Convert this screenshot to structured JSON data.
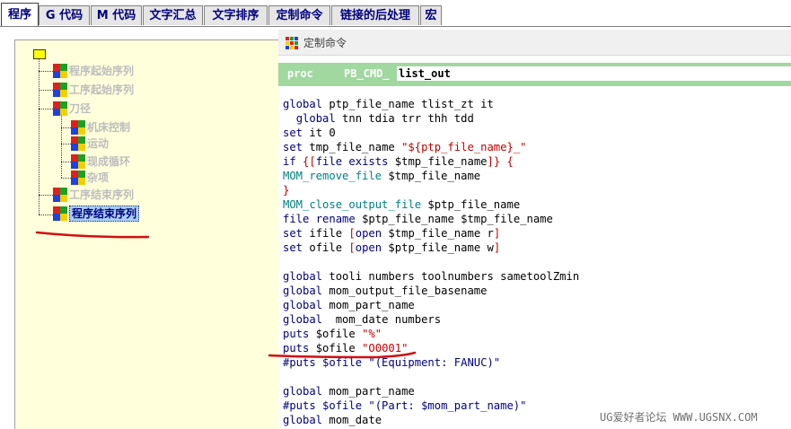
{
  "tabs": [
    {
      "label": "程序"
    },
    {
      "label": "G 代码"
    },
    {
      "label": "M 代码"
    },
    {
      "label": "文字汇总"
    },
    {
      "label": "文字排序"
    },
    {
      "label": "定制命令"
    },
    {
      "label": "链接的后处理"
    },
    {
      "label": "宏"
    }
  ],
  "tree": {
    "nodes": [
      {
        "label": "程序起始序列"
      },
      {
        "label": "工序起始序列"
      },
      {
        "label": "刀径"
      },
      {
        "label": "机床控制"
      },
      {
        "label": "运动"
      },
      {
        "label": "现成循环"
      },
      {
        "label": "杂项"
      },
      {
        "label": "工序结束序列"
      },
      {
        "label": "程序结束序列"
      }
    ]
  },
  "window": {
    "title": "定制命令",
    "proc_keyword": "proc",
    "proc_prefix": "PB_CMD_",
    "proc_name": "list_out"
  },
  "code_lines": [
    "global ptp_file_name tlist_zt it",
    "  global tnn tdia trr thh tdd",
    "set it 0",
    "set tmp_file_name \"${ptp_file_name}_\"",
    "if {[file exists $tmp_file_name]} {",
    "MOM_remove_file $tmp_file_name",
    "}",
    "MOM_close_output_file $ptp_file_name",
    "file rename $ptp_file_name $tmp_file_name",
    "set ifile [open $tmp_file_name r]",
    "set ofile [open $ptp_file_name w]",
    "",
    "global tooli numbers toolnumbers sametoolZmin",
    "global mom_output_file_basename",
    "global mom_part_name",
    "global  mom_date numbers",
    "puts $ofile \"%\"",
    "puts $ofile \"O0001\"",
    "#puts $ofile \"(Equipment: FANUC)\"",
    "",
    "global mom_part_name",
    "#puts $ofile \"(Part: $mom_part_name)\"",
    "global mom_date"
  ],
  "watermark": "UG爱好者论坛 WWW.UGSNX.COM",
  "colors": {
    "proc_bar": "#a0d8a0",
    "tree_bg": "#ffffdc",
    "annotation": "#d01010"
  }
}
